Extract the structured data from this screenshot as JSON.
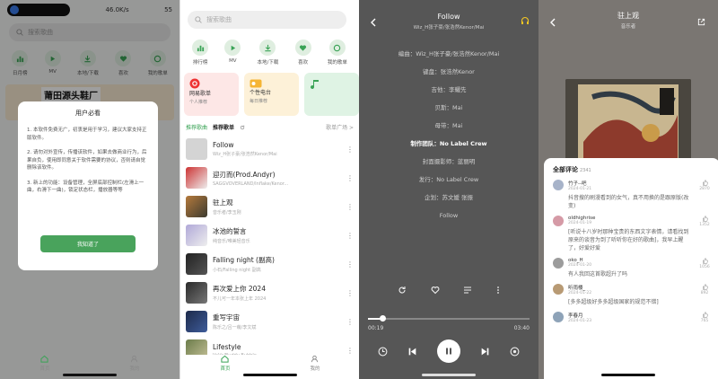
{
  "panel1": {
    "status": {
      "speed": "46.0K/s",
      "battery": "55"
    },
    "search_placeholder": "搜索歌曲",
    "quick": [
      {
        "label": "日月榜",
        "icon": "chart-icon"
      },
      {
        "label": "MV",
        "icon": "video-icon"
      },
      {
        "label": "本地/下载",
        "icon": "download-icon"
      },
      {
        "label": "喜欢",
        "icon": "heart-icon"
      },
      {
        "label": "我的歌单",
        "icon": "playlist-icon"
      }
    ],
    "ad_text": "莆田源头鞋厂",
    "dialog": {
      "title": "用户必看",
      "para1": "1. 本软件免费无广，初衷是用于学习，建议大家支持正版软件。",
      "para2": "2. 请勿对外宣传，传播该软件，如果去做商业行为，后果自负，使用即同意关于软件需要的协议，否则请自觉删除该软件。",
      "para3": "3. 新上的功能：设备管理，全屏底部控制栏(左滑上一曲，右滑下一曲)，锁定状态栏，播放器等等",
      "ok": "我知道了"
    },
    "nav": {
      "home": "首页",
      "mine": "我的"
    }
  },
  "panel2": {
    "search_placeholder": "搜索歌曲",
    "quick": [
      {
        "label": "排行榜",
        "icon": "chart-icon"
      },
      {
        "label": "MV",
        "icon": "video-icon"
      },
      {
        "label": "本地/下载",
        "icon": "download-icon"
      },
      {
        "label": "喜欢",
        "icon": "heart-icon"
      },
      {
        "label": "我的歌单",
        "icon": "playlist-icon"
      }
    ],
    "cards": [
      {
        "title": "网易歌单",
        "sub": "个人推荐"
      },
      {
        "title": "个性电台",
        "sub": "每日推荐"
      },
      {
        "title": "",
        "sub": ""
      }
    ],
    "tabs": {
      "recommend": "推荐歌曲",
      "playlist": "推荐歌单",
      "square": "歌单广场 >"
    },
    "songs": [
      {
        "name": "Follow",
        "artist": "Wiz_H张子豪/张浩然Kenor/Mai"
      },
      {
        "name": "迎刃而(Prod.Andyr)",
        "artist": "SAGGVOVERLAND/Inflake/Kenor..."
      },
      {
        "name": "驻上观",
        "artist": "音乐者/李玉刚"
      },
      {
        "name": "冰池的誓言",
        "artist": "纯音乐/唯美轻音乐"
      },
      {
        "name": "Falling night (副高)",
        "artist": "小石/Falling night 副高"
      },
      {
        "name": "再次爱上你 2024",
        "artist": "不儿可一年本张上年 2024"
      },
      {
        "name": "重写宇宙",
        "artist": "陈乐之/吕一萌/李文斌"
      },
      {
        "name": "Lifestyle",
        "artist": "VaVa/Buddy Bubble"
      }
    ],
    "nav": {
      "home": "首页",
      "mine": "我的"
    }
  },
  "panel3": {
    "title": "Follow",
    "artist": "Wiz_H张子豪/张浩然Kenor/Mai",
    "lyrics": [
      {
        "text": "编曲：Wiz_H张子豪/张浩然Kenor/Mai",
        "hl": false
      },
      {
        "text": "键盘：张浩然Kenor",
        "hl": false
      },
      {
        "text": "吉他：李耀先",
        "hl": false
      },
      {
        "text": "贝斯：Mai",
        "hl": false
      },
      {
        "text": "母带：Mai",
        "hl": false
      },
      {
        "text": "制作团队：No Label Crew",
        "hl": true
      },
      {
        "text": "封面摄影师：蓝丽明",
        "hl": false
      },
      {
        "text": "发行：No Label Crew",
        "hl": false
      },
      {
        "text": "企划：苏文媛 张振",
        "hl": false
      },
      {
        "text": "Follow",
        "hl": false
      }
    ],
    "time_current": "00:19",
    "time_total": "03:40",
    "progress": 0.09
  },
  "panel4": {
    "title": "驻上观",
    "subtitle": "音乐者",
    "comments_title": "全部评论",
    "comments_count": "2341",
    "comments": [
      {
        "name": "竹子--吧",
        "date": "2024-01-21",
        "text": "抖音搜的刷漫看到的女气，真不用换的是跟原版(改变)",
        "likes": "2870"
      },
      {
        "name": "oldhighrise",
        "date": "2024-01-19",
        "text": "[听说十八岁时那种宝贵的东西文字表情，请看找到原来的谈音为到了听听你在好的歌曲]，我早上醒了，好爱好爱",
        "likes": "1352"
      },
      {
        "name": "oko_H",
        "date": "2024-01-20",
        "text": "有人我回这首歌超升了吗",
        "likes": "1056"
      },
      {
        "name": "听雨楼_",
        "date": "2024-01-22",
        "text": "[多多超级好多多超级国家的规范不错]",
        "likes": "892"
      },
      {
        "name": "李春月",
        "date": "2024-01-23",
        "text": "",
        "likes": "765"
      }
    ]
  }
}
